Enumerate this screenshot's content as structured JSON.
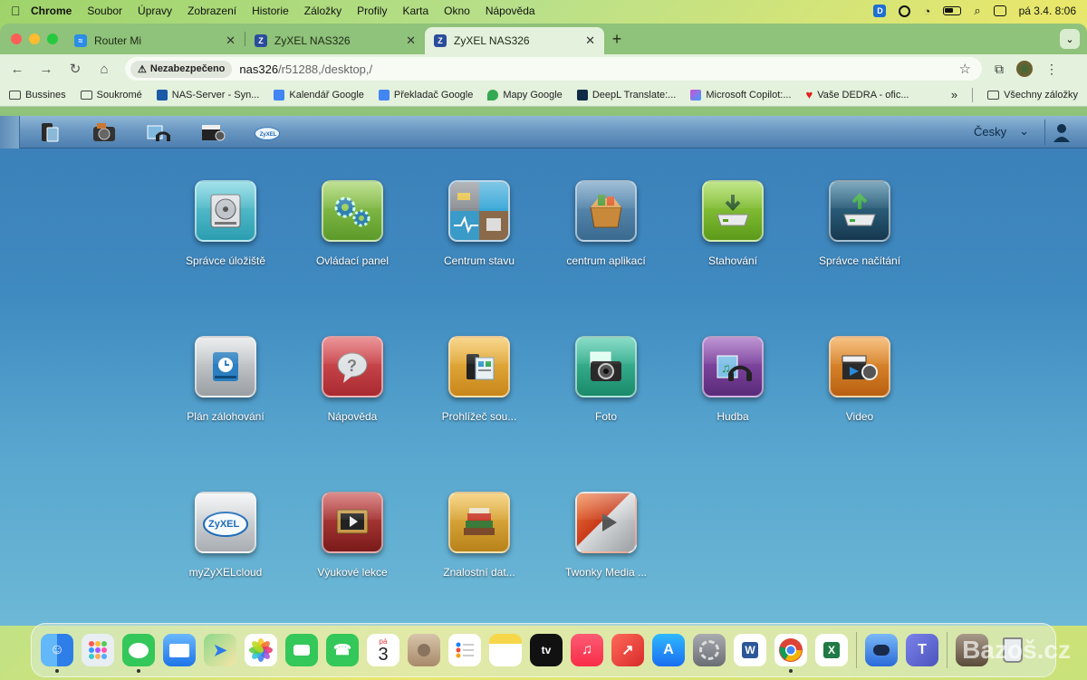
{
  "menubar": {
    "app": "Chrome",
    "items": [
      "Soubor",
      "Úpravy",
      "Zobrazení",
      "Historie",
      "Záložky",
      "Profily",
      "Karta",
      "Okno",
      "Nápověda"
    ],
    "clock": "pá 3.4.  8:06"
  },
  "tabs": [
    {
      "title": "Router Mi",
      "icon": "wifi-icon",
      "active": false
    },
    {
      "title": "ZyXEL NAS326",
      "icon": "zyxel-z-icon",
      "active": false
    },
    {
      "title": "ZyXEL NAS326",
      "icon": "zyxel-z-icon",
      "active": true
    }
  ],
  "toolbar": {
    "security_label": "Nezabezpečeno",
    "url_host": "nas326",
    "url_path": "/r51288,/desktop,/"
  },
  "bookmarks": {
    "items": [
      {
        "label": "Bussines",
        "icon": "folder-icon",
        "color": ""
      },
      {
        "label": "Soukromé",
        "icon": "folder-icon",
        "color": ""
      },
      {
        "label": "NAS-Server - Syn...",
        "icon": "dsm-icon",
        "color": "#1a5aa8"
      },
      {
        "label": "Kalendář Google",
        "icon": "calendar-icon",
        "color": "#4285f4"
      },
      {
        "label": "Překladač Google",
        "icon": "translate-icon",
        "color": "#4285f4"
      },
      {
        "label": "Mapy Google",
        "icon": "maps-pin-icon",
        "color": "#34a853"
      },
      {
        "label": "DeepL Translate:...",
        "icon": "deepl-icon",
        "color": "#0f2b46"
      },
      {
        "label": "Microsoft Copilot:...",
        "icon": "copilot-icon",
        "color": "#d14fd1"
      },
      {
        "label": "Vaše DEDRA - ofic...",
        "icon": "heart-icon",
        "color": "#e0201b"
      }
    ],
    "more": "»",
    "all_label": "Všechny záložky"
  },
  "nas": {
    "language": "Česky",
    "quickbar": [
      "storage-tray-icon",
      "photo-camera-icon",
      "music-headphones-icon",
      "video-clapper-icon",
      "zyxel-cloud-icon"
    ],
    "apps": [
      {
        "label": "Správce úložiště",
        "icon": "hard-disk-icon",
        "color": "#3fb3c4"
      },
      {
        "label": "Ovládací panel",
        "icon": "gears-icon",
        "color": "#78b23c"
      },
      {
        "label": "Centrum stavu",
        "icon": "status-grid-icon",
        "color": "#6fa6c8"
      },
      {
        "label": "centrum aplikací",
        "icon": "app-box-icon",
        "color": "#4f7fa8"
      },
      {
        "label": "Stahování",
        "icon": "download-drive-icon",
        "color": "#7cbf2f"
      },
      {
        "label": "Správce načítání",
        "icon": "upload-drive-icon",
        "color": "#2a5a7a"
      },
      {
        "label": "Plán zálohování",
        "icon": "backup-clock-icon",
        "color": "#b8bcc0"
      },
      {
        "label": "Nápověda",
        "icon": "help-bubble-icon",
        "color": "#c8373f"
      },
      {
        "label": "Prohlížeč sou...",
        "icon": "file-browser-icon",
        "color": "#e2a52a"
      },
      {
        "label": "Foto",
        "icon": "photo-camera-icon",
        "color": "#2faa8a"
      },
      {
        "label": "Hudba",
        "icon": "music-headphones-icon",
        "color": "#7a3f9a"
      },
      {
        "label": "Video",
        "icon": "video-clapper-icon",
        "color": "#d9821f"
      },
      {
        "label": "myZyXELcloud",
        "icon": "zyxel-cloud-icon",
        "color": "#c9cdd1"
      },
      {
        "label": "Výukové lekce",
        "icon": "tutorial-film-icon",
        "color": "#a82a2a"
      },
      {
        "label": "Znalostní dat...",
        "icon": "books-icon",
        "color": "#d9a52a"
      },
      {
        "label": "Twonky Media ...",
        "icon": "twonky-play-icon",
        "color": "#e05a2a"
      }
    ]
  },
  "dock": {
    "apps": [
      {
        "name": "finder-icon",
        "color": "#2d8cf0",
        "running": true
      },
      {
        "name": "launchpad-icon",
        "color": "#e9eef3",
        "running": false
      },
      {
        "name": "messages-icon",
        "color": "#34c759",
        "running": true
      },
      {
        "name": "mail-icon",
        "color": "#3a8ff5",
        "running": false
      },
      {
        "name": "maps-icon",
        "color": "#5bbf6a",
        "running": false
      },
      {
        "name": "photos-icon",
        "color": "#f4f4f4",
        "running": false
      },
      {
        "name": "facetime-icon",
        "color": "#34c759",
        "running": false
      },
      {
        "name": "phone-icon",
        "color": "#34c759",
        "running": false
      },
      {
        "name": "calendar-icon",
        "color": "#ffffff",
        "running": false
      },
      {
        "name": "contacts-icon",
        "color": "#c9a98a",
        "running": false
      },
      {
        "name": "reminders-icon",
        "color": "#ffffff",
        "running": false
      },
      {
        "name": "notes-icon",
        "color": "#f7d64a",
        "running": false
      },
      {
        "name": "apple-tv-icon",
        "color": "#111111",
        "running": false
      },
      {
        "name": "music-icon",
        "color": "#fa3c4c",
        "running": false
      },
      {
        "name": "rocket-icon",
        "color": "#ef3b3b",
        "running": false
      },
      {
        "name": "app-store-icon",
        "color": "#1e8ef7",
        "running": false
      },
      {
        "name": "system-settings-icon",
        "color": "#8e9196",
        "running": false
      },
      {
        "name": "word-icon",
        "color": "#2b5797",
        "running": false
      },
      {
        "name": "chrome-icon",
        "color": "#ffffff",
        "running": true
      },
      {
        "name": "excel-icon",
        "color": "#1f7a45",
        "running": false
      }
    ],
    "extra": [
      {
        "name": "vpn-icon",
        "color": "#3b7dd8",
        "running": false
      },
      {
        "name": "teams-icon",
        "color": "#5b5fc7",
        "running": false
      },
      {
        "name": "photo-stack-icon",
        "color": "#7a6a5a",
        "running": false
      },
      {
        "name": "trash-icon",
        "color": "#d5dade",
        "running": false
      }
    ],
    "calendar_day": "3",
    "calendar_weekday": "pá",
    "tv_label": "tv",
    "word_letter": "W",
    "excel_letter": "X"
  },
  "watermark": "Bazoš.cz"
}
